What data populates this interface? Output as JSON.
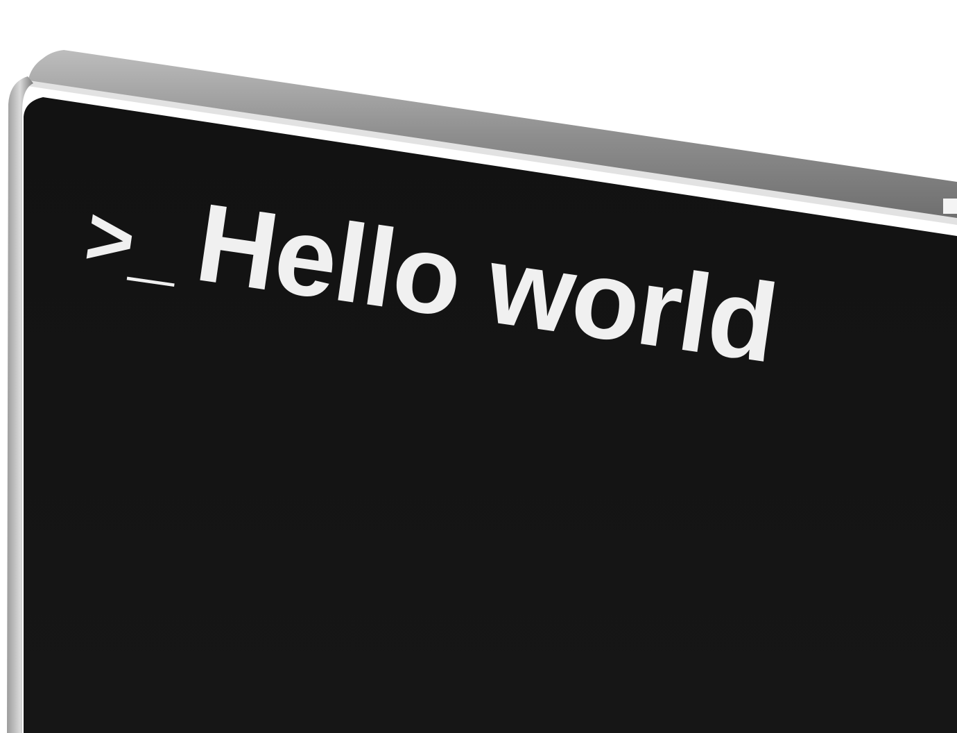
{
  "screen": {
    "prompt_symbol": ">_",
    "text": "Hello world"
  },
  "colors": {
    "background": "#ffffff",
    "bezel_top": "#9a9a9a",
    "bezel_edge": "#d8d8d8",
    "screen": "#141414",
    "text": "#f0f0f0"
  },
  "icons": {
    "prompt": "terminal-prompt-icon"
  }
}
